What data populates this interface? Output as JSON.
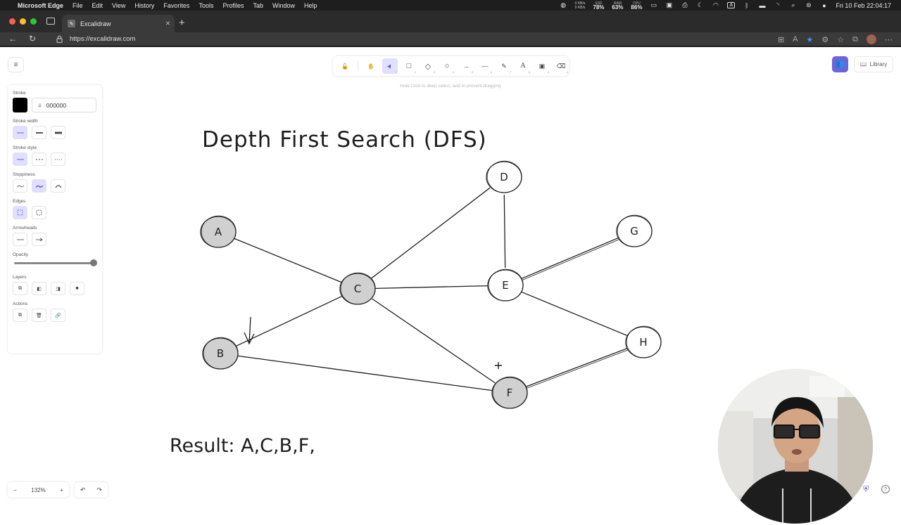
{
  "menubar": {
    "apple": "",
    "app": "Microsoft Edge",
    "items": [
      "File",
      "Edit",
      "View",
      "History",
      "Favorites",
      "Tools",
      "Profiles",
      "Tab",
      "Window",
      "Help"
    ],
    "net_up": "0 KB/s",
    "net_down": "0 KB/s",
    "ssd_label": "SSD",
    "ssd": "78%",
    "ram_label": "RAM",
    "ram": "63%",
    "cpu_label": "CPU",
    "cpu": "86%",
    "input_indicator": "A",
    "datetime": "Fri 10 Feb  22:04:17"
  },
  "browser": {
    "tab_title": "Excalidraw",
    "tab_close": "×",
    "new_tab": "+",
    "url": "https://excalidraw.com",
    "back": "←",
    "reload": "↻"
  },
  "excalidraw": {
    "menu_icon": "≡",
    "hint": "Hold Cmd to deep select, and to prevent dragging",
    "library_label": "Library",
    "tools": [
      {
        "name": "lock-tool",
        "glyph": "🔓",
        "kbd": ""
      },
      {
        "name": "hand-tool",
        "glyph": "✋",
        "kbd": ""
      },
      {
        "name": "selection-tool",
        "glyph": "➤",
        "kbd": "1"
      },
      {
        "name": "rectangle-tool",
        "glyph": "□",
        "kbd": "2"
      },
      {
        "name": "diamond-tool",
        "glyph": "◇",
        "kbd": "3"
      },
      {
        "name": "ellipse-tool",
        "glyph": "○",
        "kbd": "4"
      },
      {
        "name": "arrow-tool",
        "glyph": "→",
        "kbd": "5"
      },
      {
        "name": "line-tool",
        "glyph": "—",
        "kbd": "6"
      },
      {
        "name": "draw-tool",
        "glyph": "✎",
        "kbd": "7"
      },
      {
        "name": "text-tool",
        "glyph": "A",
        "kbd": "8"
      },
      {
        "name": "image-tool",
        "glyph": "▣",
        "kbd": "9"
      },
      {
        "name": "eraser-tool",
        "glyph": "⌫",
        "kbd": "0"
      }
    ],
    "properties": {
      "stroke_label": "Stroke",
      "stroke_hash": "#",
      "stroke_hex": "000000",
      "stroke_color": "#000000",
      "stroke_width_label": "Stroke width",
      "stroke_style_label": "Stroke style",
      "sloppiness_label": "Sloppiness",
      "edges_label": "Edges",
      "arrowheads_label": "Arrowheads",
      "opacity_label": "Opacity",
      "opacity_value": 100,
      "layers_label": "Layers",
      "actions_label": "Actions"
    },
    "zoom": "132%",
    "zoom_out": "−",
    "zoom_in": "+",
    "undo": "↶",
    "redo": "↷",
    "help": "?"
  },
  "drawing": {
    "title": "Depth First Search (DFS)",
    "result": "Result: A,C,B,F,",
    "visited_fill": "#d0d0d0",
    "nodes": [
      {
        "id": "A",
        "visited": true
      },
      {
        "id": "B",
        "visited": true
      },
      {
        "id": "C",
        "visited": true
      },
      {
        "id": "D",
        "visited": false
      },
      {
        "id": "E",
        "visited": false
      },
      {
        "id": "F",
        "visited": true
      },
      {
        "id": "G",
        "visited": false
      },
      {
        "id": "H",
        "visited": false
      }
    ],
    "edges": [
      [
        "A",
        "C"
      ],
      [
        "C",
        "D"
      ],
      [
        "C",
        "E"
      ],
      [
        "C",
        "B"
      ],
      [
        "C",
        "F"
      ],
      [
        "D",
        "E"
      ],
      [
        "E",
        "G"
      ],
      [
        "E",
        "H"
      ],
      [
        "B",
        "F"
      ],
      [
        "F",
        "H"
      ]
    ]
  }
}
